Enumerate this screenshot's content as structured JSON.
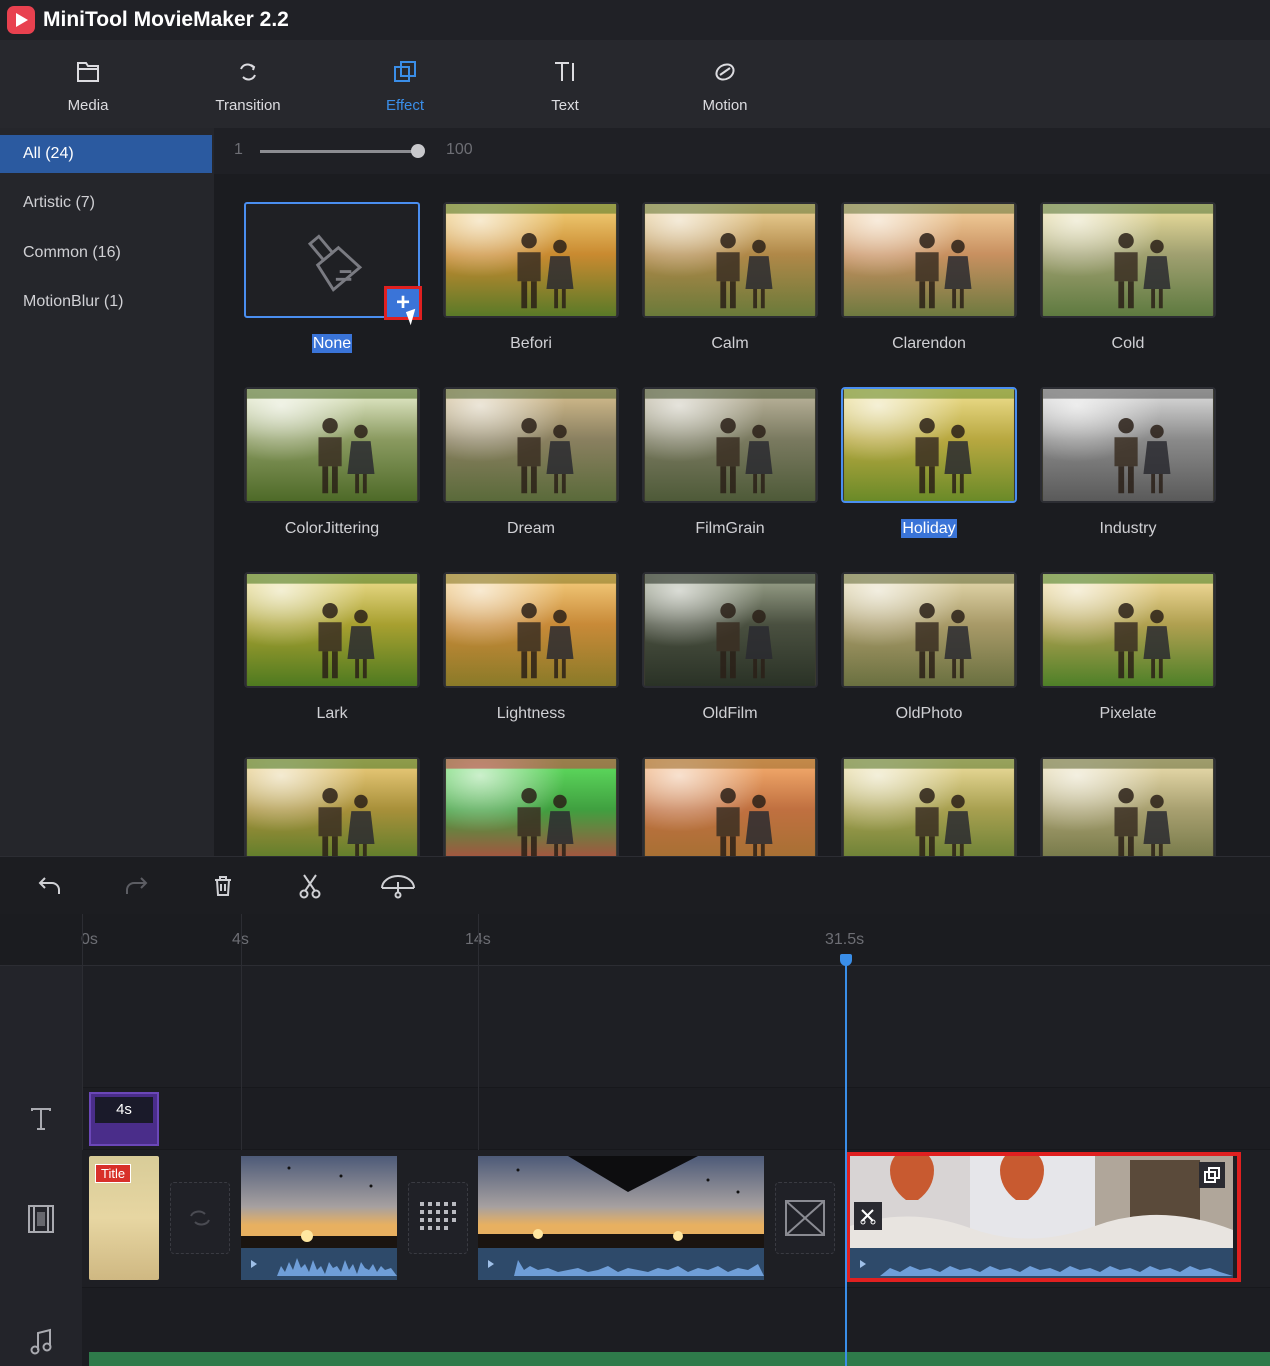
{
  "app": {
    "title": "MiniTool MovieMaker 2.2"
  },
  "toolbar": {
    "items": [
      {
        "label": "Media",
        "icon": "folder-icon"
      },
      {
        "label": "Transition",
        "icon": "transition-icon"
      },
      {
        "label": "Effect",
        "icon": "effect-icon",
        "active": true
      },
      {
        "label": "Text",
        "icon": "text-icon"
      },
      {
        "label": "Motion",
        "icon": "motion-icon"
      }
    ]
  },
  "sidebar": {
    "categories": [
      {
        "label": "All  (24)",
        "active": true
      },
      {
        "label": "Artistic  (7)"
      },
      {
        "label": "Common  (16)"
      },
      {
        "label": "MotionBlur  (1)"
      }
    ]
  },
  "slider": {
    "min": "1",
    "max": "100"
  },
  "effects": [
    {
      "name": "None"
    },
    {
      "name": "Befori"
    },
    {
      "name": "Calm"
    },
    {
      "name": "Clarendon"
    },
    {
      "name": "Cold"
    },
    {
      "name": "ColorJittering"
    },
    {
      "name": "Dream"
    },
    {
      "name": "FilmGrain"
    },
    {
      "name": "Holiday",
      "selected": true
    },
    {
      "name": "Industry"
    },
    {
      "name": "Lark"
    },
    {
      "name": "Lightness"
    },
    {
      "name": "OldFilm"
    },
    {
      "name": "OldPhoto"
    },
    {
      "name": "Pixelate"
    }
  ],
  "timeline": {
    "ruler": [
      "0s",
      "4s",
      "14s",
      "31.5s"
    ],
    "text_clip_duration": "4s",
    "title_badge": "Title"
  },
  "colors": {
    "accent": "#3a8ee8",
    "highlight_red": "#e02020",
    "selection": "#3a74d8"
  }
}
